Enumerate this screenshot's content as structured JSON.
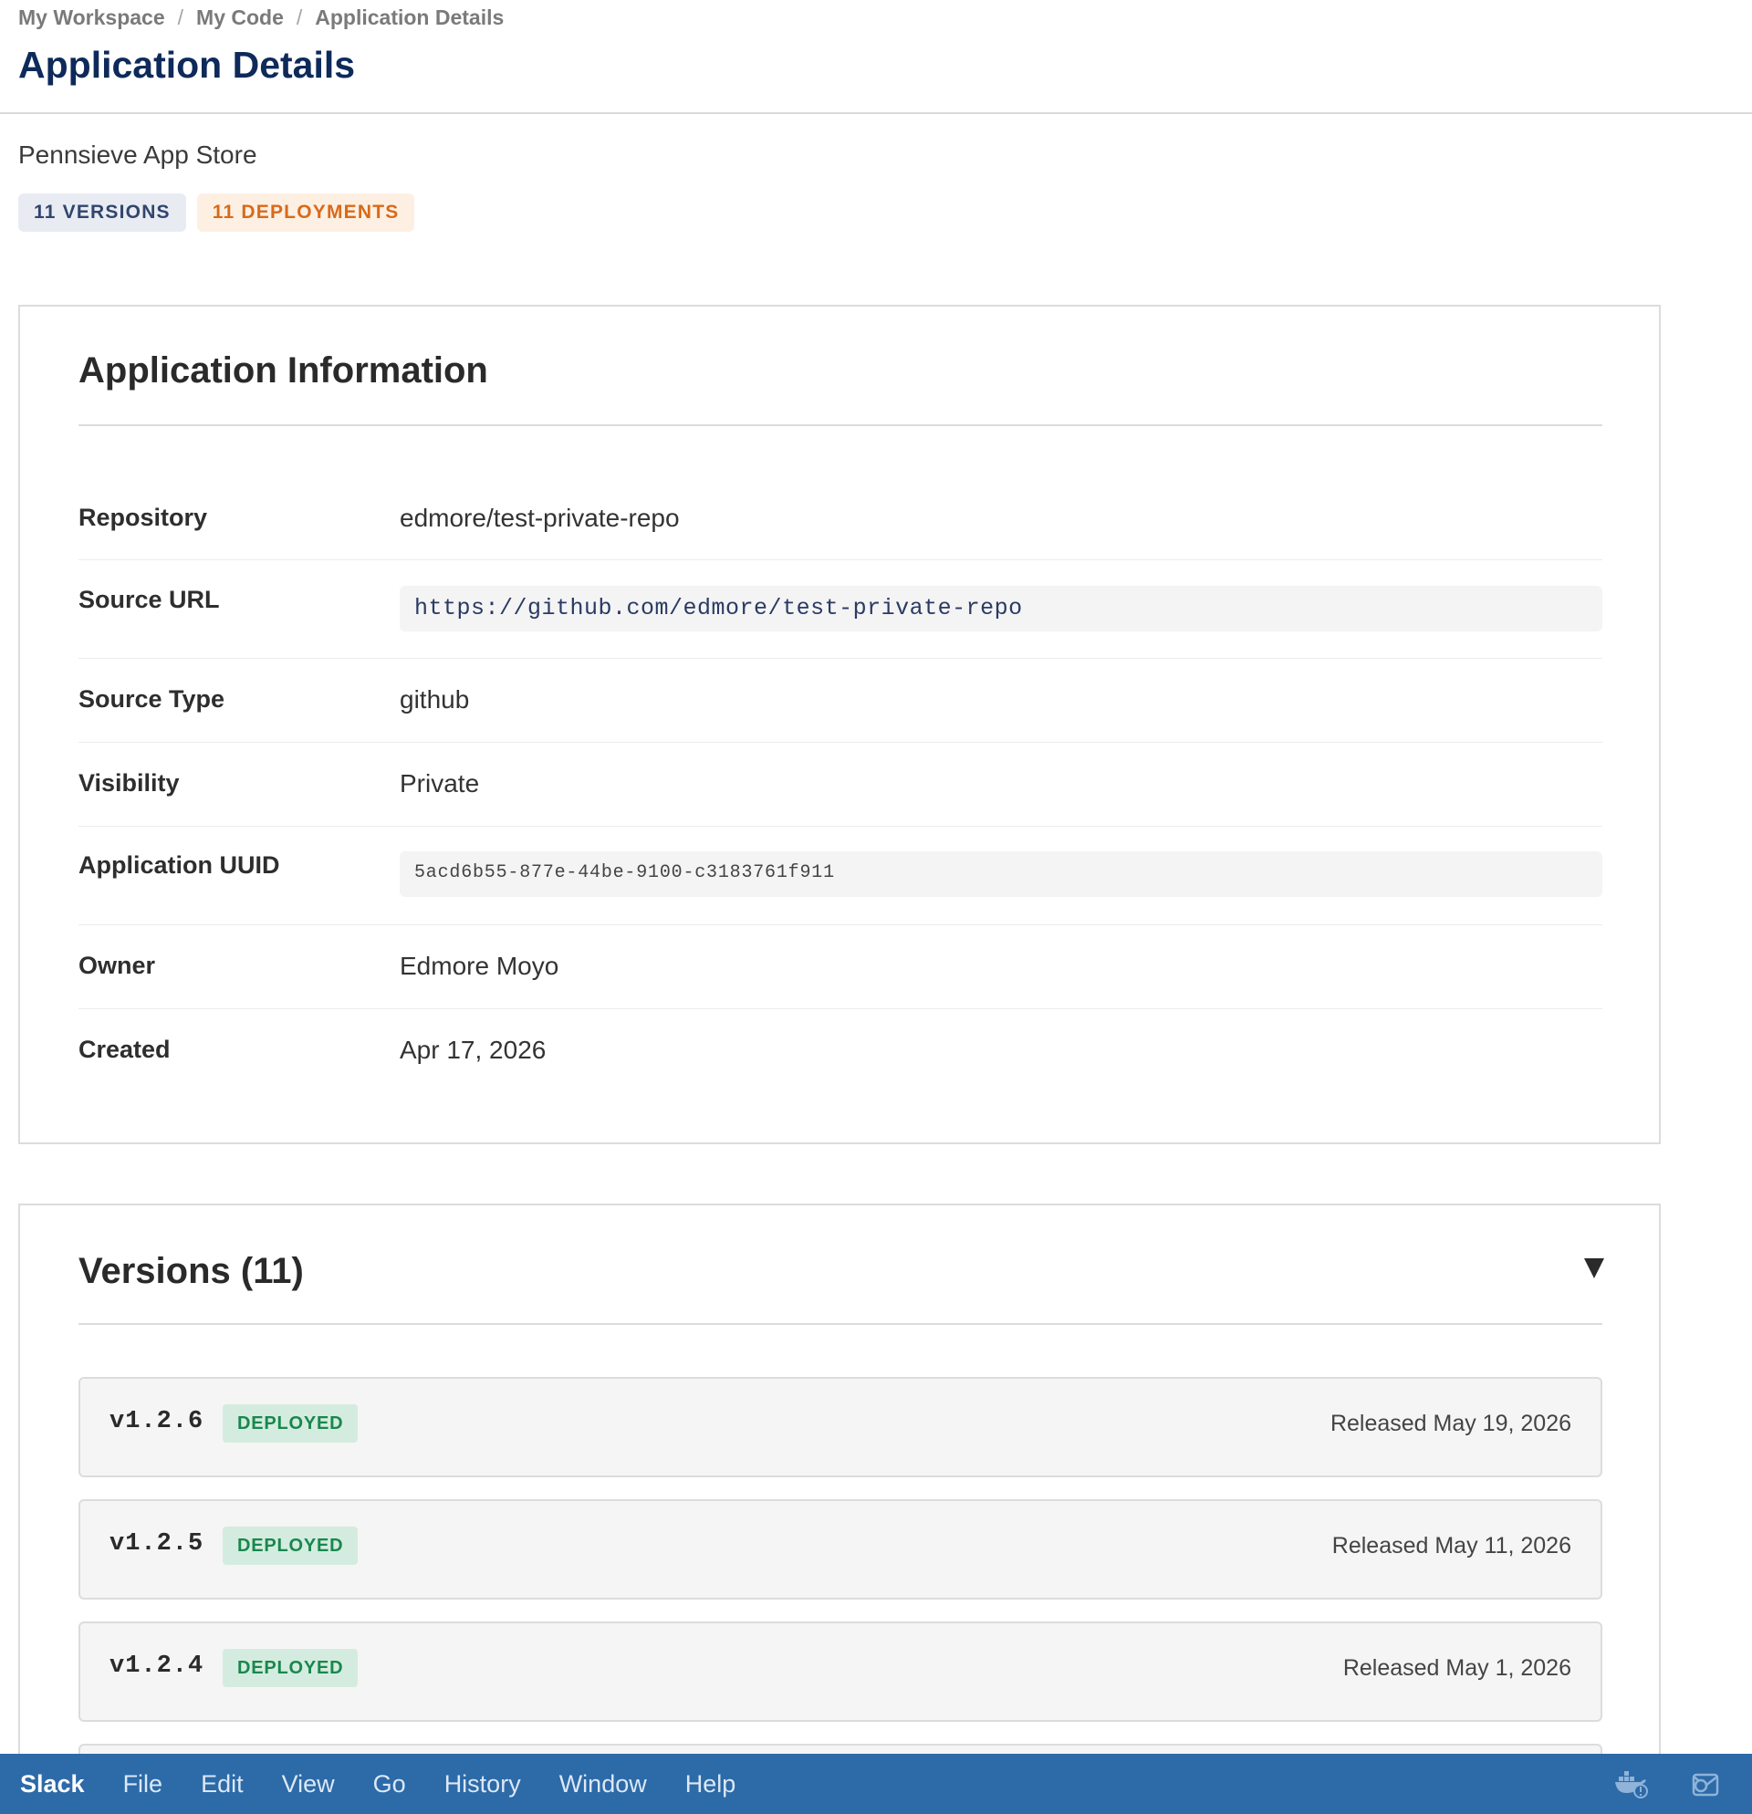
{
  "breadcrumb": {
    "items": [
      "My Workspace",
      "My Code",
      "Application Details"
    ],
    "separator": "/"
  },
  "page": {
    "title": "Application Details",
    "store_name": "Pennsieve App Store",
    "badges": {
      "versions": "11 VERSIONS",
      "deployments": "11 DEPLOYMENTS"
    }
  },
  "info": {
    "title": "Application Information",
    "rows": [
      {
        "label": "Repository",
        "value": "edmore/test-private-repo"
      },
      {
        "label": "Source URL",
        "value": "https://github.com/edmore/test-private-repo"
      },
      {
        "label": "Source Type",
        "value": "github"
      },
      {
        "label": "Visibility",
        "value": "Private"
      },
      {
        "label": "Application UUID",
        "value": "5acd6b55-877e-44be-9100-c3183761f911"
      },
      {
        "label": "Owner",
        "value": "Edmore Moyo"
      },
      {
        "label": "Created",
        "value": "Apr 17, 2026"
      }
    ]
  },
  "versions": {
    "title": "Versions (11)",
    "toggle_icon": "chevron-down-icon",
    "items": [
      {
        "tag": "v1.2.6",
        "status": "DEPLOYED",
        "released": "Released May 19, 2026"
      },
      {
        "tag": "v1.2.5",
        "status": "DEPLOYED",
        "released": "Released May 11, 2026"
      },
      {
        "tag": "v1.2.4",
        "status": "DEPLOYED",
        "released": "Released May 1, 2026"
      }
    ]
  },
  "menubar": {
    "app": "Slack",
    "items": [
      "File",
      "Edit",
      "View",
      "Go",
      "History",
      "Window",
      "Help"
    ],
    "tray_icons": [
      "docker-icon",
      "outlook-icon"
    ]
  },
  "colors": {
    "title_navy": "#0e2a5a",
    "deploy_orange": "#d86a1a",
    "deployed_green": "#19874d",
    "menubar_blue": "#2c6aa8"
  }
}
